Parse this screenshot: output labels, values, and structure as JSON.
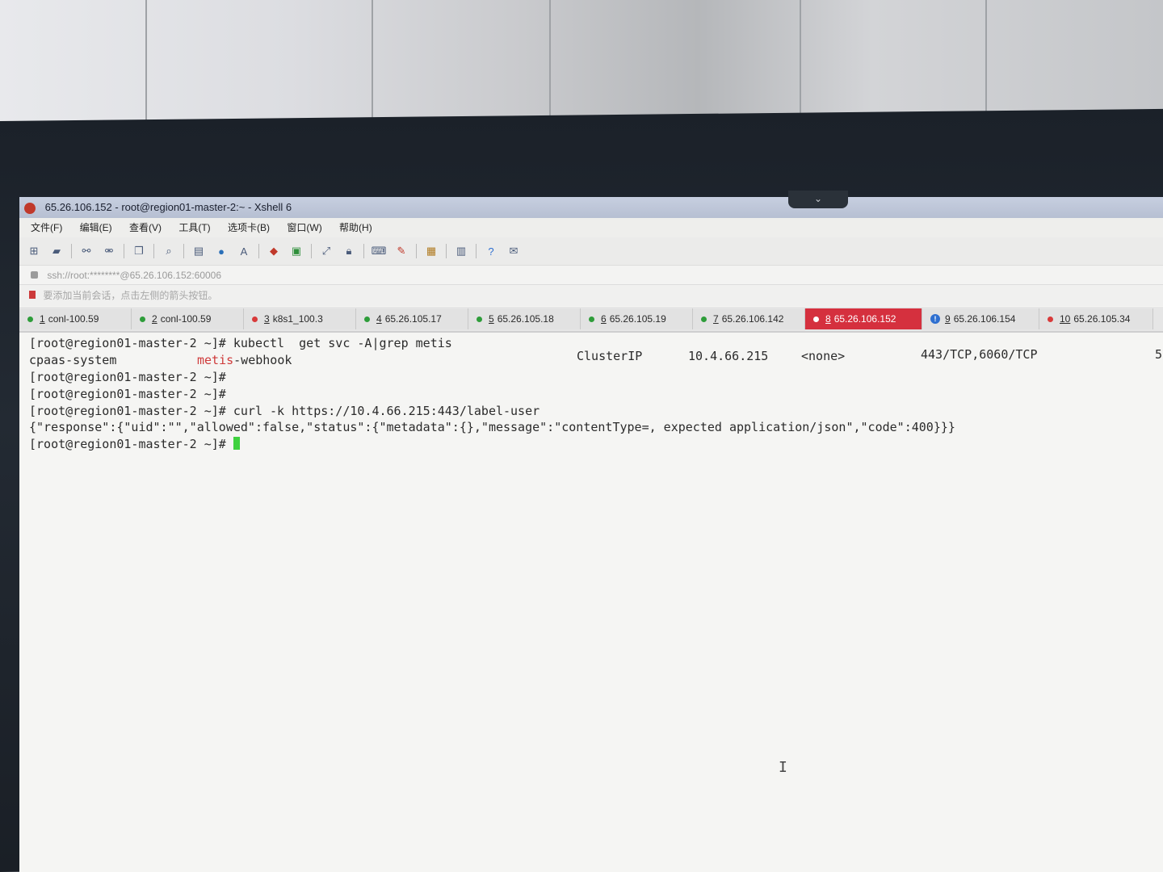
{
  "window": {
    "title": "65.26.106.152 - root@region01-master-2:~ - Xshell 6"
  },
  "menu": [
    "文件(F)",
    "编辑(E)",
    "查看(V)",
    "工具(T)",
    "选项卡(B)",
    "窗口(W)",
    "帮助(H)"
  ],
  "address": "ssh://root:********@65.26.106.152:60006",
  "hint": "要添加当前会话，点击左侧的箭头按钮。",
  "tabs": [
    {
      "num": "1",
      "label": "conl-100.59",
      "status": "green"
    },
    {
      "num": "2",
      "label": "conl-100.59",
      "status": "green"
    },
    {
      "num": "3",
      "label": "k8s1_100.3",
      "status": "red"
    },
    {
      "num": "4",
      "label": "65.26.105.17",
      "status": "green"
    },
    {
      "num": "5",
      "label": "65.26.105.18",
      "status": "green"
    },
    {
      "num": "6",
      "label": "65.26.105.19",
      "status": "green"
    },
    {
      "num": "7",
      "label": "65.26.106.142",
      "status": "green"
    },
    {
      "num": "8",
      "label": "65.26.106.152",
      "status": "active"
    },
    {
      "num": "9",
      "label": "65.26.106.154",
      "status": "info"
    },
    {
      "num": "10",
      "label": "65.26.105.34",
      "status": "red"
    }
  ],
  "terminal": {
    "line1": "[root@region01-master-2 ~]# kubectl  get svc -A|grep metis",
    "line2_ns": "cpaas-system",
    "line2_match": "metis",
    "line2_rest": "-webhook",
    "line2_type": "ClusterIP",
    "line2_ip": "10.4.66.215",
    "line2_ext": "<none>",
    "line2_ports": "443/TCP,6060/TCP",
    "line2_age": "5",
    "line3": "[root@region01-master-2 ~]#",
    "line4": "[root@region01-master-2 ~]#",
    "line5": "[root@region01-master-2 ~]# curl -k https://10.4.66.215:443/label-user",
    "line6": "{\"response\":{\"uid\":\"\",\"allowed\":false,\"status\":{\"metadata\":{},\"message\":\"contentType=, expected application/json\",\"code\":400}}}",
    "line7": "[root@region01-master-2 ~]# "
  },
  "colors": {
    "active_tab": "#d5303e",
    "status_green": "#2e9d3a",
    "status_red": "#d83a3a",
    "cursor": "#3fd13f",
    "grep_match": "#cf3a3a"
  }
}
